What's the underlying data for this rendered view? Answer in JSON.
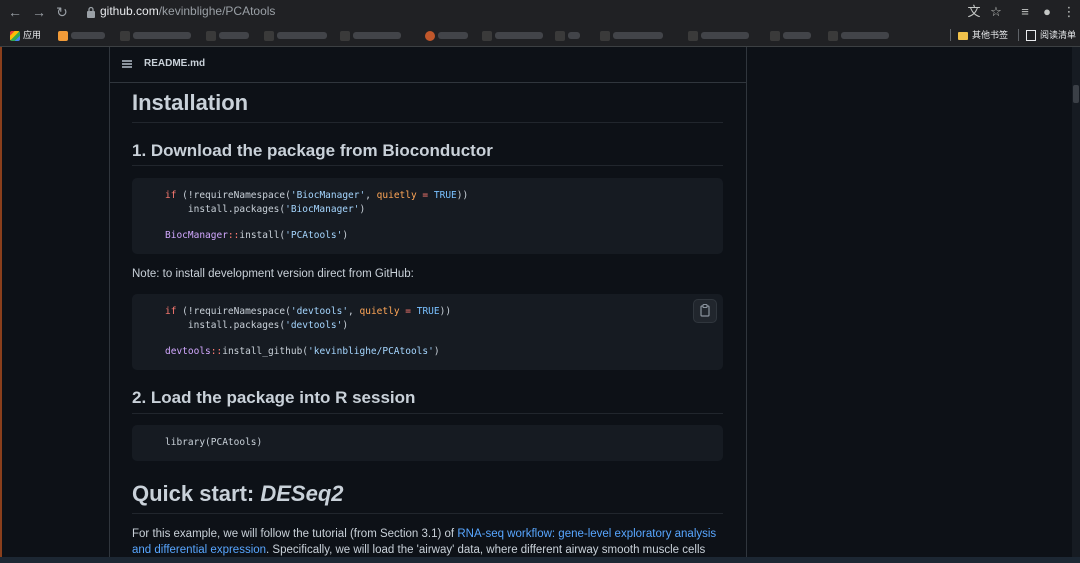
{
  "browser": {
    "url_domain": "github.com",
    "url_path": "/kevinblighe/PCAtools",
    "apps_label": "应用",
    "other_bookmarks": "其他书签",
    "reading_list": "阅读清单"
  },
  "colors": {
    "page_bg": "#0d1117",
    "code_bg": "#161b22",
    "link": "#58a6ff",
    "keyword": "#ff7b72",
    "string": "#a5d6ff"
  },
  "readme": {
    "file_name": "README.md",
    "installation_title": "Installation",
    "step1_title": "1. Download the package from Bioconductor",
    "code1": {
      "l1_if": "if",
      "l1_a": " (!requireNamespace(",
      "l1_str": "'BiocManager'",
      "l1_b": ", ",
      "l1_arg": "quietly",
      "l1_eq": " = ",
      "l1_true": "TRUE",
      "l1_end": "))",
      "l2_a": "    install.packages(",
      "l2_str": "'BiocManager'",
      "l2_end": ")",
      "l3_ns": "BiocManager",
      "l3_op": "::",
      "l3_fn": "install(",
      "l3_str": "'PCAtools'",
      "l3_end": ")"
    },
    "note": "Note: to install development version direct from GitHub:",
    "code2": {
      "l1_if": "if",
      "l1_a": " (!requireNamespace(",
      "l1_str": "'devtools'",
      "l1_b": ", ",
      "l1_arg": "quietly",
      "l1_eq": " = ",
      "l1_true": "TRUE",
      "l1_end": "))",
      "l2_a": "    install.packages(",
      "l2_str": "'devtools'",
      "l2_end": ")",
      "l3_ns": "devtools",
      "l3_op": "::",
      "l3_fn": "install_github(",
      "l3_str": "'kevinblighe/PCAtools'",
      "l3_end": ")"
    },
    "step2_title": "2. Load the package into R session",
    "code3": "library(PCAtools)",
    "quickstart_title": "Quick start: ",
    "quickstart_emph": "DESeq2",
    "para_a": "For this example, we will follow the tutorial (from Section 3.1) of ",
    "para_link": "RNA-seq workflow: gene-level exploratory analysis and differential expression",
    "para_b": ". Specifically, we will load the 'airway' data, where different airway smooth muscle cells were"
  }
}
